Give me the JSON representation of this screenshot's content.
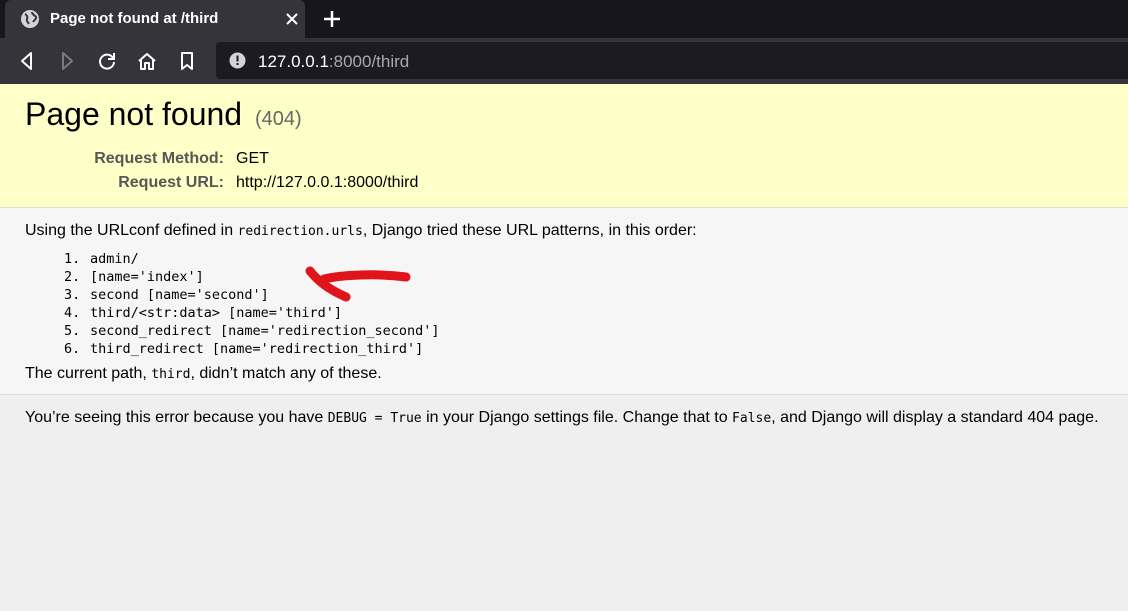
{
  "browser": {
    "tab": {
      "title": "Page not found at /third",
      "icon": "globe-icon"
    },
    "url": {
      "host": "127.0.0.1",
      "rest": ":8000/third"
    },
    "buttons": [
      "back-icon",
      "forward-icon",
      "reload-icon",
      "home-icon",
      "bookmark-icon"
    ]
  },
  "error": {
    "title": "Page not found",
    "status": "(404)",
    "request_method_label": "Request Method:",
    "request_method": "GET",
    "request_url_label": "Request URL:",
    "request_url": "http://127.0.0.1:8000/third"
  },
  "info": {
    "intro_before": "Using the URLconf defined in ",
    "urlconf": "redirection.urls",
    "intro_after": ", Django tried these URL patterns, in this order:",
    "patterns": [
      {
        "num": "1.",
        "text": "admin/"
      },
      {
        "num": "2.",
        "text": "[name='index']"
      },
      {
        "num": "3.",
        "text": "second [name='second']"
      },
      {
        "num": "4.",
        "text": "third/<str:data> [name='third']"
      },
      {
        "num": "5.",
        "text": "second_redirect [name='redirection_second']"
      },
      {
        "num": "6.",
        "text": "third_redirect [name='redirection_third']"
      }
    ],
    "current_before": "The current path, ",
    "current_path": "third",
    "current_after": ", didn’t match any of these."
  },
  "explanation": {
    "p1": "You’re seeing this error because you have ",
    "code1": "DEBUG = True",
    "p2": " in your Django settings file. Change that to ",
    "code2": "False",
    "p3": ", and Django will display a standard 404 page."
  },
  "colors": {
    "summary_bg": "#ffffc8",
    "annotation": "#e0141b"
  }
}
